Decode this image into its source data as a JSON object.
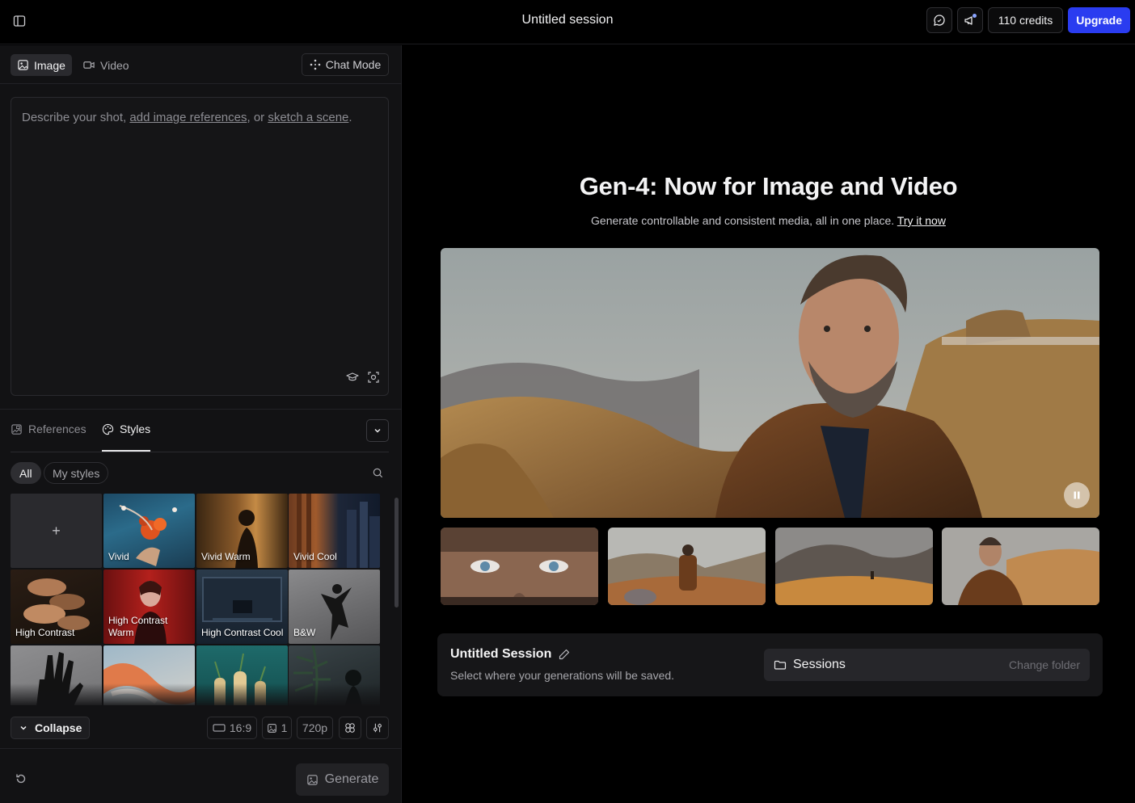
{
  "topbar": {
    "session_title": "Untitled session",
    "credits_label": "110 credits",
    "upgrade_label": "Upgrade"
  },
  "mode_tabs": [
    {
      "label": "Image",
      "icon": "image-icon",
      "active": true
    },
    {
      "label": "Video",
      "icon": "video-icon",
      "active": false
    }
  ],
  "chat_mode_label": "Chat Mode",
  "prompt": {
    "prefix": "Describe your shot, ",
    "link1": "add image references",
    "mid": ", or ",
    "link2": "sketch a scene",
    "suffix": "."
  },
  "ref_tabs": [
    {
      "label": "References",
      "icon": "references-icon",
      "active": false
    },
    {
      "label": "Styles",
      "icon": "palette-icon",
      "active": true
    }
  ],
  "filters": [
    {
      "label": "All",
      "active": true
    },
    {
      "label": "My styles",
      "active": false
    }
  ],
  "styles": [
    {
      "label": "",
      "kind": "add"
    },
    {
      "label": "Vivid"
    },
    {
      "label": "Vivid Warm"
    },
    {
      "label": "Vivid Cool"
    },
    {
      "label": "High Contrast"
    },
    {
      "label": "High Contrast Warm"
    },
    {
      "label": "High Contrast Cool"
    },
    {
      "label": "B&W"
    }
  ],
  "controls": {
    "collapse_label": "Collapse",
    "aspect_ratio": "16:9",
    "image_count": "1",
    "resolution": "720p"
  },
  "generate_label": "Generate",
  "hero": {
    "title": "Gen-4: Now for Image and Video",
    "subtitle": "Generate controllable and consistent media, all in one place. ",
    "cta": "Try it now"
  },
  "session_card": {
    "title": "Untitled Session",
    "subtitle": "Select where your generations will be saved.",
    "folder_name": "Sessions",
    "change_folder_label": "Change folder"
  },
  "colors": {
    "accent": "#2a3cf0",
    "panel": "#121214",
    "background": "#000000"
  }
}
